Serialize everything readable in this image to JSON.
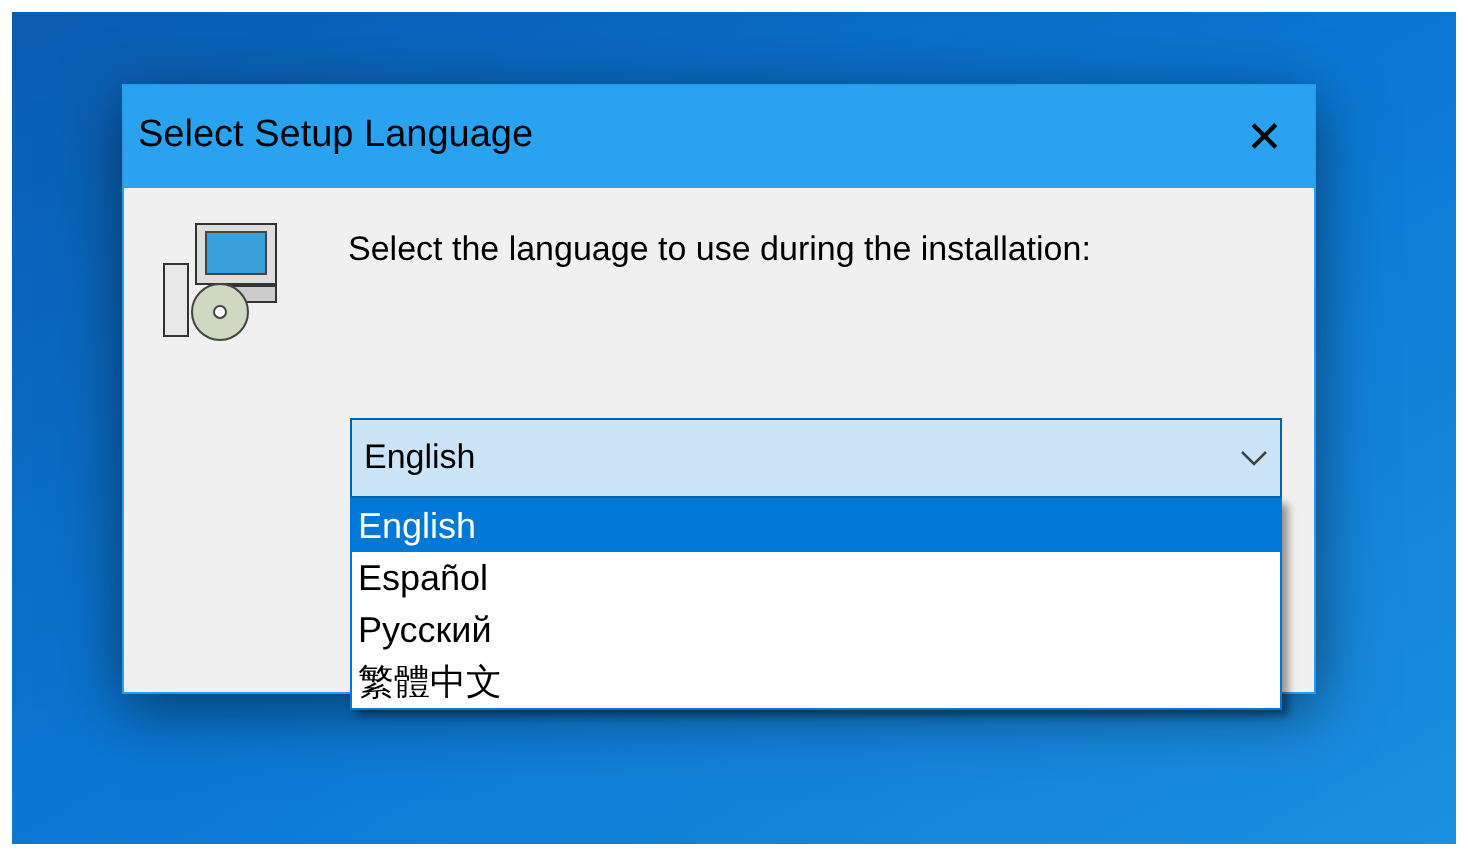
{
  "window": {
    "title": "Select Setup Language",
    "close": "✕"
  },
  "prompt": "Select the language to use during the installation:",
  "language_select": {
    "value": "English",
    "expanded": true,
    "options": [
      {
        "label": "English",
        "selected": true
      },
      {
        "label": "Español",
        "selected": false
      },
      {
        "label": "Русский",
        "selected": false
      },
      {
        "label": "繁體中文",
        "selected": false
      }
    ]
  }
}
